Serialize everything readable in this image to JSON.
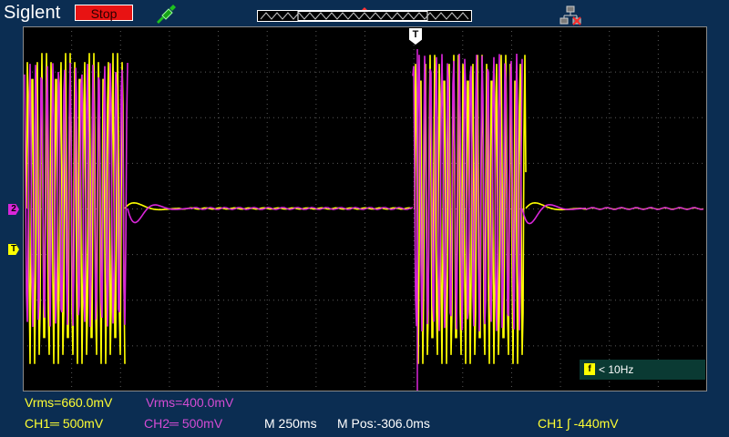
{
  "header": {
    "brand": "Siglent",
    "run_state": "Stop"
  },
  "screen": {
    "channel_marker": "2",
    "trigger_marker": "T",
    "trigger_position_marker": "T",
    "frequency_readout": "< 10Hz",
    "frequency_icon": "f"
  },
  "measurements": {
    "ch1_vrms": "Vrms=660.0mV",
    "ch2_vrms": "Vrms=400.0mV"
  },
  "status_bar": {
    "ch1": "CH1═ 500mV",
    "ch2": "CH2═ 500mV",
    "timebase": "M 250ms",
    "mpos": "M Pos:-306.0ms",
    "trigger": "CH1 ∫ -440mV"
  },
  "colors": {
    "ch1": "#ffff00",
    "ch2": "#d926d9",
    "background": "#0b2d52",
    "run_button": "#e81313"
  },
  "chart_data": {
    "type": "line",
    "series": [
      {
        "name": "CH1",
        "volts_per_div": 0.5,
        "vrms": 0.66
      },
      {
        "name": "CH2",
        "volts_per_div": 0.5,
        "vrms": 0.4
      }
    ],
    "grid": true,
    "timebase": "250ms/div"
  }
}
